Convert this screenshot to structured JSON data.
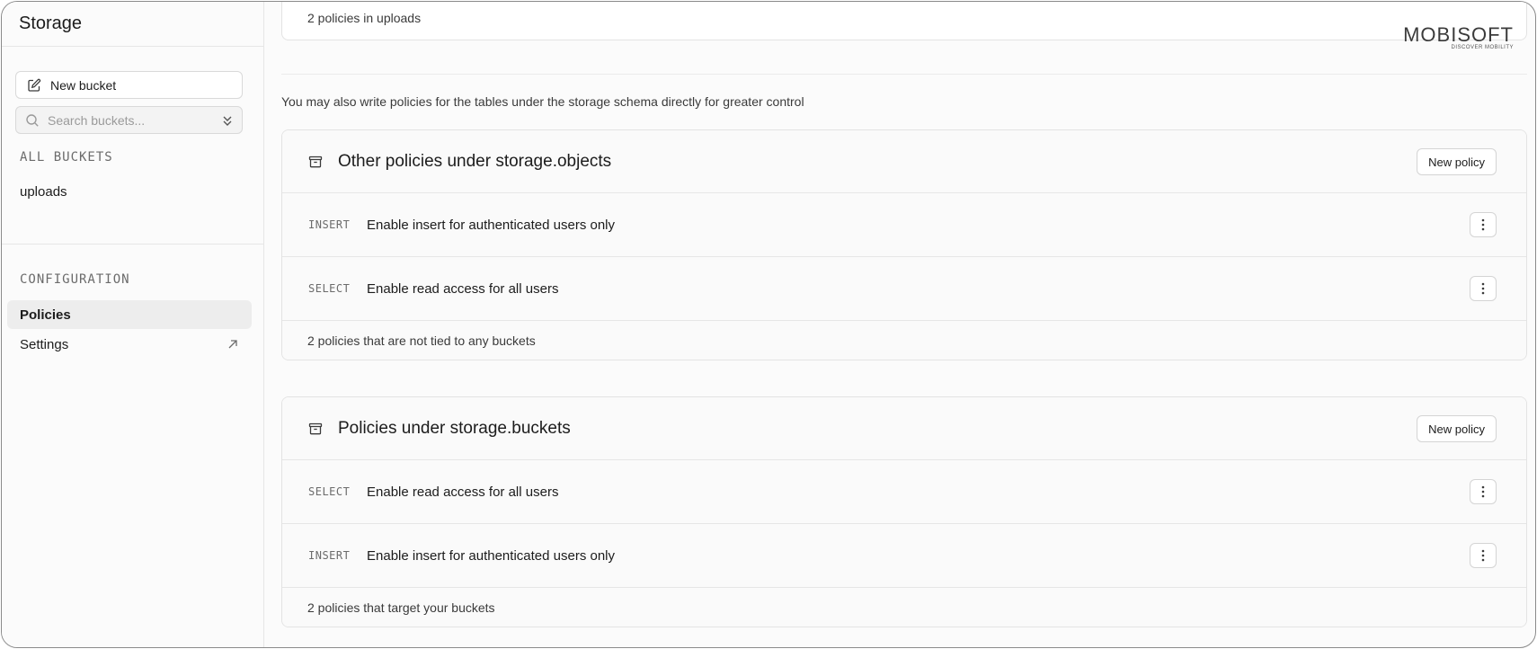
{
  "sidebar": {
    "title": "Storage",
    "new_bucket_label": "New bucket",
    "search_placeholder": "Search buckets...",
    "all_buckets_label": "ALL BUCKETS",
    "buckets": [
      "uploads"
    ],
    "configuration_label": "CONFIGURATION",
    "policies_label": "Policies",
    "settings_label": "Settings"
  },
  "main": {
    "top_card_footer": "2 policies in uploads",
    "intro_text": "You may also write policies for the tables under the storage schema directly for greater control",
    "sections": [
      {
        "title": "Other policies under storage.objects",
        "new_policy_label": "New policy",
        "policies": [
          {
            "command": "INSERT",
            "name": "Enable insert for authenticated users only"
          },
          {
            "command": "SELECT",
            "name": "Enable read access for all users"
          }
        ],
        "footer": "2 policies that are not tied to any buckets"
      },
      {
        "title": "Policies under storage.buckets",
        "new_policy_label": "New policy",
        "policies": [
          {
            "command": "SELECT",
            "name": "Enable read access for all users"
          },
          {
            "command": "INSERT",
            "name": "Enable insert for authenticated users only"
          }
        ],
        "footer": "2 policies that target your buckets"
      }
    ]
  },
  "watermark": {
    "brand": "MOBISOFT",
    "tagline": "DISCOVER MOBILITY"
  },
  "colors": {
    "background": "#fbfbfb",
    "border": "#e3e3e3",
    "active_item_bg": "#ededed",
    "text": "#1c1c1c",
    "muted": "#6b6b6b"
  }
}
